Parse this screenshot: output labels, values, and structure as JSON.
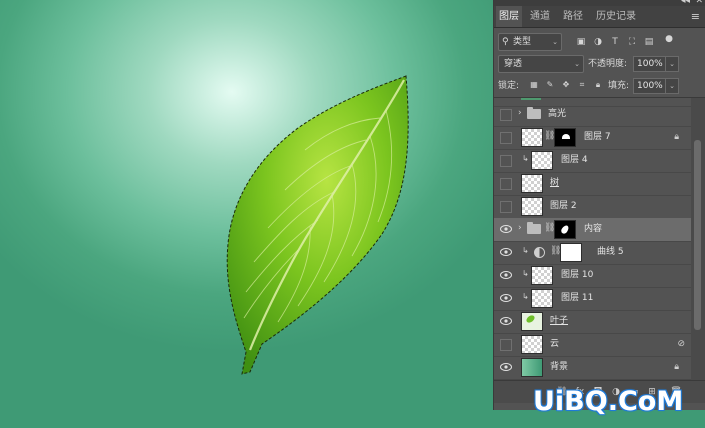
{
  "tabs": [
    {
      "label": "图层"
    },
    {
      "label": "通道"
    },
    {
      "label": "路径"
    },
    {
      "label": "历史记录"
    }
  ],
  "filter": {
    "label": "类型"
  },
  "blend_mode": "穿透",
  "opacity": {
    "label": "不透明度:",
    "value": "100%"
  },
  "lock": {
    "label": "锁定:"
  },
  "fill": {
    "label": "填充:",
    "value": "100%"
  },
  "layers": [
    {
      "name": "高光"
    },
    {
      "name": "图层 7"
    },
    {
      "name": "图层 4"
    },
    {
      "name": "树"
    },
    {
      "name": "图层 2"
    },
    {
      "name": "内容"
    },
    {
      "name": "曲线 5"
    },
    {
      "name": "图层 10"
    },
    {
      "name": "图层 11"
    },
    {
      "name": "叶子"
    },
    {
      "name": "云"
    },
    {
      "name": "背景"
    }
  ],
  "watermark": "UiBQ.CoM",
  "colors": {
    "canvas_green": "#4ba67f",
    "panel_bg": "#535353",
    "selected_layer": "#6c6c6c",
    "leaf_green": "#7cc51f"
  }
}
